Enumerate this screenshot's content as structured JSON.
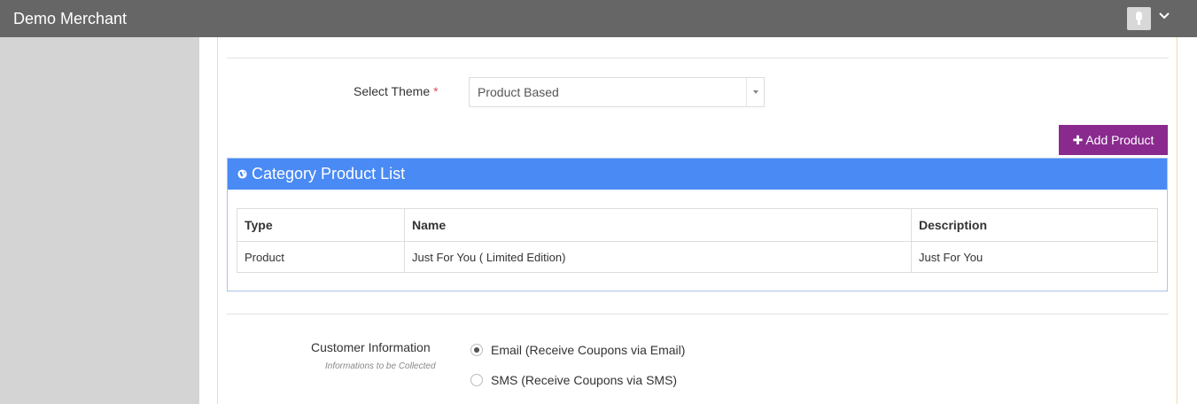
{
  "header": {
    "merchant_name": "Demo Merchant"
  },
  "form": {
    "theme_label": "Select Theme",
    "required_mark": "*",
    "theme_value": "Product Based",
    "add_product_label": "Add Product"
  },
  "product_list": {
    "title": "Category Product List",
    "columns": [
      "Type",
      "Name",
      "Description"
    ],
    "rows": [
      [
        "Product",
        "Just For You ( Limited Edition)",
        "Just For You"
      ]
    ]
  },
  "customer_info": {
    "label": "Customer Information",
    "hint": "Informations to be Collected",
    "options": [
      {
        "label": "Email (Receive Coupons via Email)",
        "selected": true
      },
      {
        "label": "SMS (Receive Coupons via SMS)",
        "selected": false
      }
    ]
  },
  "colors": {
    "topbar": "#666666",
    "sidebar": "#d4d4d4",
    "portlet_header": "#4a8af4",
    "add_button": "#8a2a8f",
    "required": "#d9534f"
  },
  "icons": {
    "avatar": "lightbulb-icon",
    "user_menu": "chevron-down-icon",
    "add": "plus-icon",
    "portlet": "globe-icon",
    "select": "caret-down-icon"
  }
}
